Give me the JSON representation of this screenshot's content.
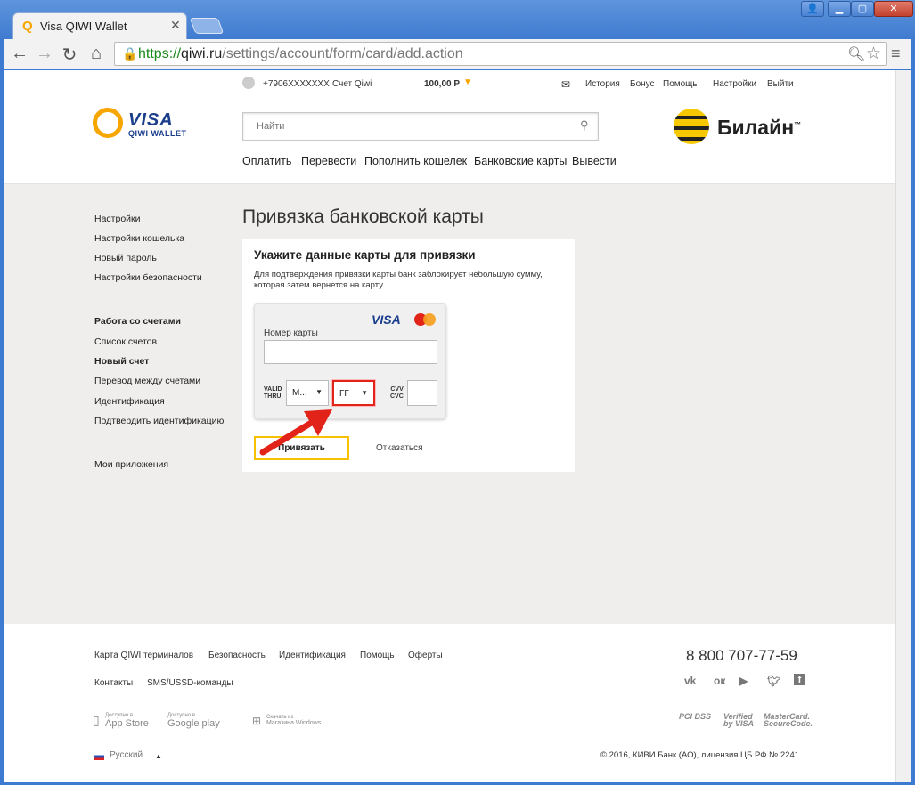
{
  "browser": {
    "tab_title": "Visa QIWI Wallet",
    "url_scheme": "https://",
    "url_host": "qiwi.ru",
    "url_path": "/settings/account/form/card/add.action"
  },
  "topbar": {
    "phone": "+7906XXXXXXX",
    "account_label": "Счет Qiwi",
    "balance": "100,00 Р",
    "links": [
      "История",
      "Бонус",
      "Помощь",
      "Настройки",
      "Выйти"
    ]
  },
  "logo": {
    "visa": "VISA",
    "wallet": "QIWI WALLET"
  },
  "search": {
    "placeholder": "Найти"
  },
  "partner": {
    "name": "Билайн",
    "tm": "™"
  },
  "main_nav": [
    "Оплатить",
    "Перевести",
    "Пополнить кошелек",
    "Банковские карты",
    "Вывести"
  ],
  "sidebar": {
    "group1": [
      "Настройки",
      "Настройки кошелька",
      "Новый пароль",
      "Настройки безопасности"
    ],
    "group2_title": "Работа со счетами",
    "group2": [
      "Список счетов",
      "Новый счет",
      "Перевод между счетами",
      "Идентификация",
      "Подтвердить идентификацию"
    ],
    "apps": "Мои приложения"
  },
  "page_title": "Привязка банковской карты",
  "form": {
    "heading": "Укажите данные карты для привязки",
    "note": "Для подтверждения привязки карты банк заблокирует небольшую сумму, которая затем вернется на карту.",
    "card_brand": "VISA",
    "card_number_label": "Номер карты",
    "valid_label": "VALID\nTHRU",
    "month_value": "М...",
    "year_value": "ГГ",
    "cvv_label": "CVV\nCVC",
    "submit": "Привязать",
    "cancel": "Отказаться"
  },
  "footer": {
    "links_row1": [
      "Карта QIWI терминалов",
      "Безопасность",
      "Идентификация",
      "Помощь",
      "Оферты"
    ],
    "links_row2": [
      "Контакты",
      "SMS/USSD-команды"
    ],
    "phone": "8 800 707-77-59",
    "apple_small": "Доступно в",
    "apple": "App Store",
    "google_small": "Доступно в",
    "google": "Google play",
    "win_small": "Скачать из",
    "win": "Магазина Windows",
    "pay_pci": "PCI DSS",
    "pay_visa": "Verified by VISA",
    "pay_mc": "MasterCard. SecureCode.",
    "language": "Русский",
    "copyright": "© 2016, КИВИ Банк (АО), лицензия ЦБ РФ № 2241"
  },
  "colors": {
    "accent": "#f7a600",
    "highlight": "#e2231a",
    "brand_blue": "#1a3e8c"
  }
}
